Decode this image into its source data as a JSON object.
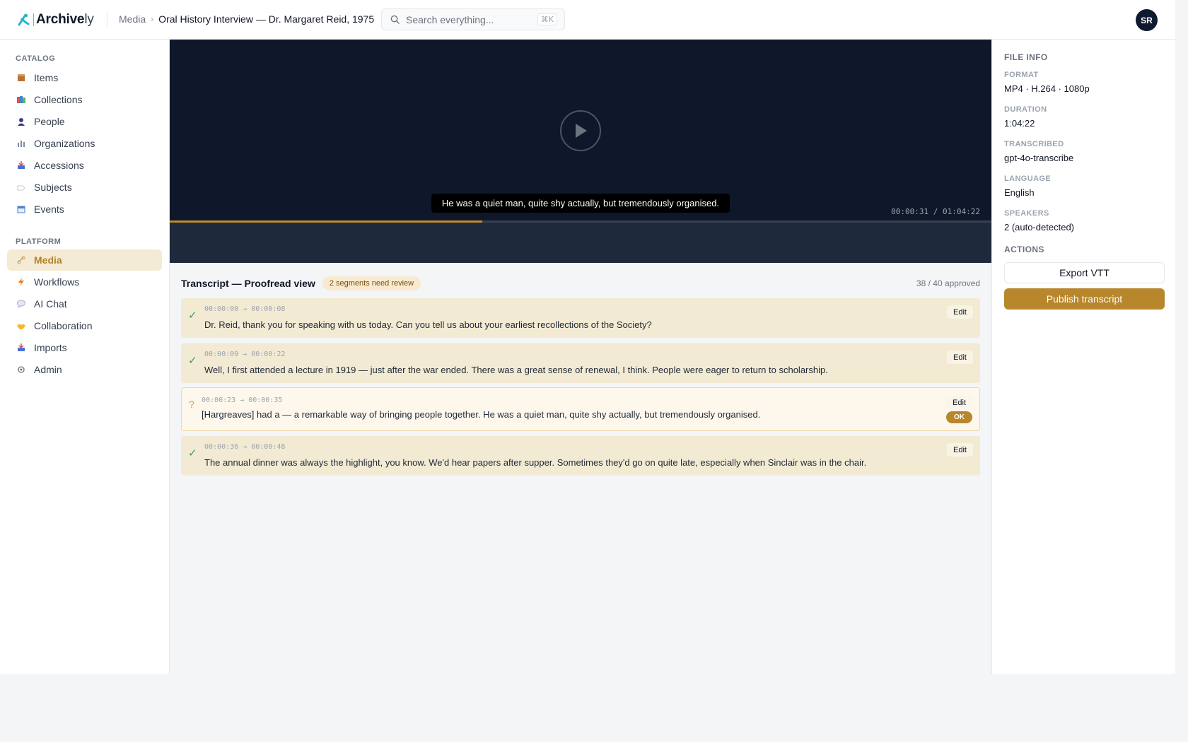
{
  "app": {
    "brand_main": "Archive",
    "brand_suffix": "ly",
    "search_placeholder": "Search everything...",
    "search_shortcut": "⌘K",
    "user_initials": "SR"
  },
  "breadcrumb": {
    "parent": "Media",
    "separator": "›",
    "current": "Oral History Interview — Dr. Margaret Reid, 1975"
  },
  "sidebar": {
    "catalog_title": "CATALOG",
    "catalog": [
      {
        "label": "Items",
        "icon": "package-icon"
      },
      {
        "label": "Collections",
        "icon": "books-icon"
      },
      {
        "label": "People",
        "icon": "person-icon"
      },
      {
        "label": "Organizations",
        "icon": "building-icon"
      },
      {
        "label": "Accessions",
        "icon": "inbox-icon"
      },
      {
        "label": "Subjects",
        "icon": "tag-icon"
      },
      {
        "label": "Events",
        "icon": "calendar-icon"
      }
    ],
    "platform_title": "PLATFORM",
    "platform": [
      {
        "label": "Media",
        "icon": "link-icon",
        "active": true
      },
      {
        "label": "Workflows",
        "icon": "lightning-icon"
      },
      {
        "label": "AI Chat",
        "icon": "chat-bubble-icon"
      },
      {
        "label": "Collaboration",
        "icon": "handshake-icon"
      },
      {
        "label": "Imports",
        "icon": "tray-icon"
      },
      {
        "label": "Admin",
        "icon": "gear-icon"
      }
    ]
  },
  "player": {
    "caption": "He was a quiet man, quite shy actually, but tremendously organised.",
    "timecode": "00:00:31 / 01:04:22",
    "progress": 0.38
  },
  "transcript": {
    "title": "Transcript — Proofread view",
    "review_badge": "2 segments need review",
    "approved": "38 / 40 approved",
    "edit_label": "Edit",
    "ok_label": "OK",
    "segments": [
      {
        "times": "00:00:00 → 00:00:08",
        "text": "Dr. Reid, thank you for speaking with us today. Can you tell us about your earliest recollections of the Society?",
        "status": "approved",
        "mark": "✓"
      },
      {
        "times": "00:00:09 → 00:00:22",
        "text": "Well, I first attended a lecture in 1919 — just after the war ended. There was a great sense of renewal, I think. People were eager to return to scholarship.",
        "status": "approved",
        "mark": "✓"
      },
      {
        "times": "00:00:23 → 00:00:35",
        "text": "[Hargreaves] had a — a remarkable way of bringing people together. He was a quiet man, quite shy actually, but tremendously organised.",
        "status": "pending",
        "mark": "?"
      },
      {
        "times": "00:00:36 → 00:00:48",
        "text": "The annual dinner was always the highlight, you know. We'd hear papers after supper. Sometimes they'd go on quite late, especially when Sinclair was in the chair.",
        "status": "approved",
        "mark": "✓"
      }
    ]
  },
  "file_info": {
    "title": "FILE INFO",
    "format_label": "FORMAT",
    "format": "MP4 · H.264 · 1080p",
    "duration_label": "DURATION",
    "duration": "1:04:22",
    "transcribed_label": "TRANSCRIBED",
    "transcribed": "gpt-4o-transcribe",
    "language_label": "LANGUAGE",
    "language": "English",
    "speakers_label": "SPEAKERS",
    "speakers": "2 (auto-detected)",
    "actions_title": "ACTIONS",
    "export_label": "Export VTT",
    "publish_label": "Publish transcript"
  },
  "colors": {
    "accent": "#b8862b",
    "active_nav_bg": "#f5ead3",
    "video_bg": "#0f172a",
    "approved_seg_bg": "#f3ead3",
    "pending_seg_bg": "#fef7ec",
    "check": "#3f9a6a"
  }
}
